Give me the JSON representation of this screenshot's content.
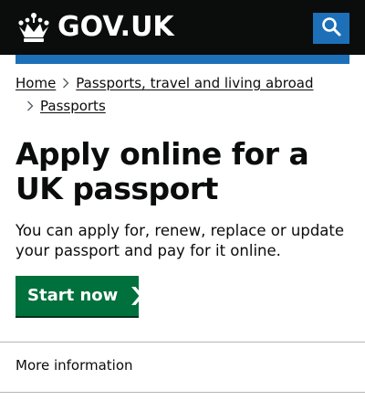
{
  "header": {
    "brand_text": "GOV.UK",
    "logo_icon": "crown-icon",
    "search_icon": "search-icon",
    "background_color": "#0b0c0c",
    "search_button_color": "#1d70b8"
  },
  "accent_bar_color": "#1d70b8",
  "breadcrumbs": {
    "items": [
      {
        "label": "Home"
      },
      {
        "label": "Passports, travel and living abroad"
      },
      {
        "label": "Passports"
      }
    ],
    "separator_icon": "chevron-right-icon"
  },
  "main": {
    "title": "Apply online for a UK passport",
    "lede": "You can apply for, renew, replace or update your passport and pay for it online.",
    "start_button": {
      "label": "Start now",
      "icon": "chevron-right-icon",
      "color": "#00703c"
    }
  },
  "more_information": {
    "label": "More information"
  }
}
